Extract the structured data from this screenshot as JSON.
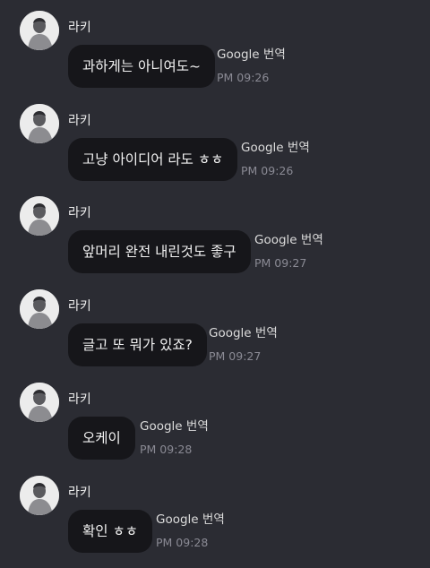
{
  "messages": [
    {
      "sender": "라키",
      "text": "과하게는 아니여도~",
      "translate_label": "Google 번역",
      "time": "PM 09:26"
    },
    {
      "sender": "라키",
      "text": "고냥 아이디어 라도 ㅎㅎ",
      "translate_label": "Google 번역",
      "time": "PM 09:26"
    },
    {
      "sender": "라키",
      "text": "앞머리 완전 내린것도 좋구",
      "translate_label": "Google 번역",
      "time": "PM 09:27"
    },
    {
      "sender": "라키",
      "text": "글고 또 뭐가 있죠?",
      "translate_label": "Google 번역",
      "time": "PM 09:27"
    },
    {
      "sender": "라키",
      "text": "오케이",
      "translate_label": "Google 번역",
      "time": "PM 09:28"
    },
    {
      "sender": "라키",
      "text": "확인 ㅎㅎ",
      "translate_label": "Google 번역",
      "time": "PM 09:28"
    }
  ]
}
